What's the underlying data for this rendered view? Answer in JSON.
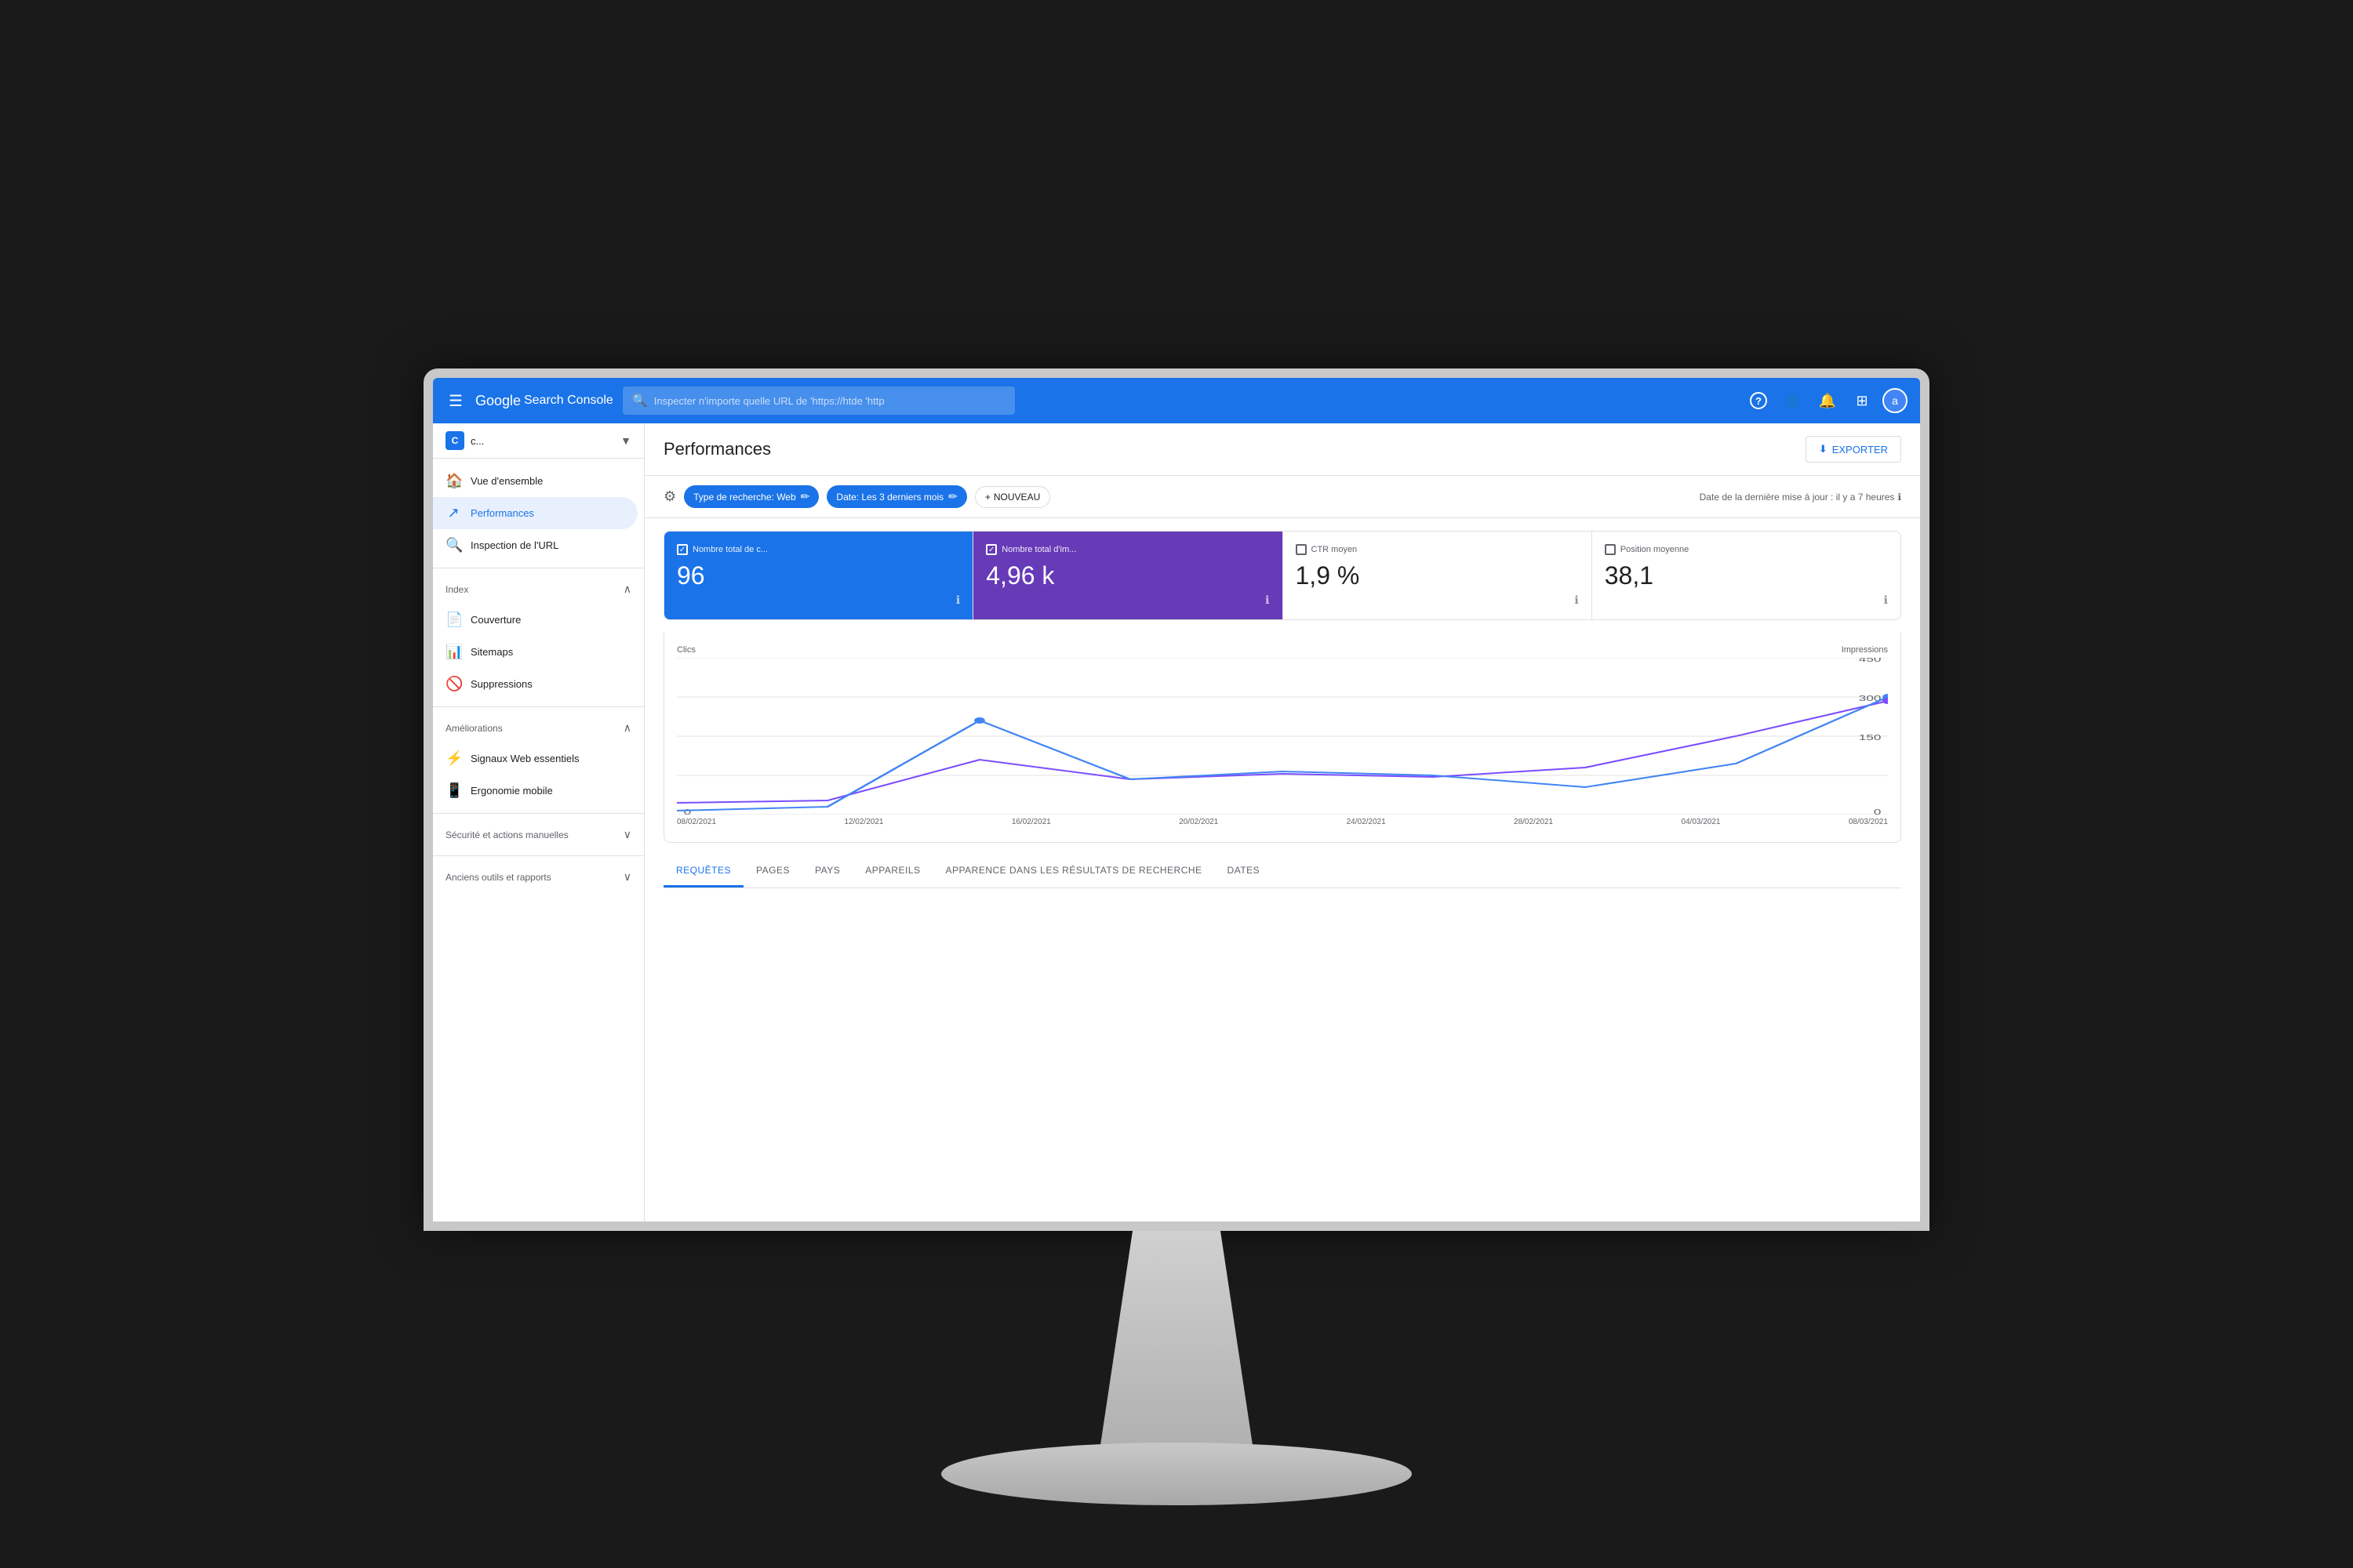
{
  "navbar": {
    "logo_google": "Google",
    "logo_gsc": "Search Console",
    "search_placeholder": "Inspecter n'importe quelle URL de 'https://htde 'http",
    "hamburger_icon": "☰",
    "help_icon": "?",
    "users_icon": "👤",
    "bell_icon": "🔔",
    "grid_icon": "⊞",
    "avatar_label": "a"
  },
  "sidebar": {
    "property_icon": "C",
    "property_name": "c...",
    "dropdown_icon": "▼",
    "items": [
      {
        "id": "vue-ensemble",
        "label": "Vue d'ensemble",
        "icon": "🏠",
        "active": false
      },
      {
        "id": "performances",
        "label": "Performances",
        "icon": "↗",
        "active": true
      },
      {
        "id": "inspection-url",
        "label": "Inspection de l'URL",
        "icon": "🔍",
        "active": false
      }
    ],
    "sections": [
      {
        "title": "Index",
        "items": [
          {
            "id": "couverture",
            "label": "Couverture",
            "icon": "📄"
          },
          {
            "id": "sitemaps",
            "label": "Sitemaps",
            "icon": "📊"
          },
          {
            "id": "suppressions",
            "label": "Suppressions",
            "icon": "🚫"
          }
        ]
      },
      {
        "title": "Améliorations",
        "items": [
          {
            "id": "signaux-web",
            "label": "Signaux Web essentiels",
            "icon": "📱"
          },
          {
            "id": "ergonomie-mobile",
            "label": "Ergonomie mobile",
            "icon": "📱"
          }
        ]
      },
      {
        "title": "Sécurité et actions manuelles",
        "items": []
      },
      {
        "title": "Anciens outils et rapports",
        "items": []
      }
    ]
  },
  "page": {
    "title": "Performances",
    "export_label": "EXPORTER",
    "export_icon": "⬇"
  },
  "filters": {
    "filter_icon": "⚙",
    "chips": [
      {
        "label": "Type de recherche: Web",
        "edit_icon": "✏"
      },
      {
        "label": "Date: Les 3 derniers mois",
        "edit_icon": "✏"
      }
    ],
    "new_btn": "+ NOUVEAU",
    "last_update": "Date de la dernière mise à jour : il y a 7 heures",
    "info_icon": "ℹ"
  },
  "metrics": [
    {
      "id": "clics",
      "label": "Nombre total de c...",
      "value": "96",
      "selected": "blue",
      "checkbox": "✓"
    },
    {
      "id": "impressions",
      "label": "Nombre total d'im...",
      "value": "4,96 k",
      "selected": "purple",
      "checkbox": "✓"
    },
    {
      "id": "ctr",
      "label": "CTR moyen",
      "value": "1,9 %",
      "selected": "none",
      "checkbox": ""
    },
    {
      "id": "position",
      "label": "Position moyenne",
      "value": "38,1",
      "selected": "none",
      "checkbox": ""
    }
  ],
  "chart": {
    "left_label": "Clics",
    "right_label": "Impressions",
    "y_right_values": [
      "450",
      "300",
      "150",
      "0"
    ],
    "y_left_values": [
      "",
      "",
      "",
      "0"
    ],
    "x_labels": [
      "08/02/2021",
      "12/02/2021",
      "16/02/2021",
      "20/02/2021",
      "24/02/2021",
      "28/02/2021",
      "04/03/2021",
      "08/03/2021"
    ]
  },
  "tabs": [
    {
      "id": "requetes",
      "label": "REQUÊTES",
      "active": true
    },
    {
      "id": "pages",
      "label": "PAGES",
      "active": false
    },
    {
      "id": "pays",
      "label": "PAYS",
      "active": false
    },
    {
      "id": "appareils",
      "label": "APPAREILS",
      "active": false
    },
    {
      "id": "apparence",
      "label": "APPARENCE DANS LES RÉSULTATS DE RECHERCHE",
      "active": false
    },
    {
      "id": "dates",
      "label": "DATES",
      "active": false
    }
  ],
  "monitor": {
    "apple_logo": ""
  }
}
